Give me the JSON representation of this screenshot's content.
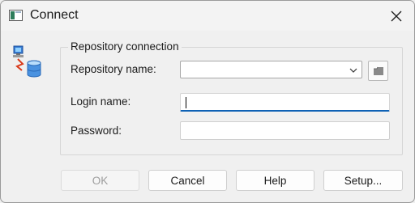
{
  "window": {
    "title": "Connect"
  },
  "icons": {
    "window": "window-app-icon",
    "close": "close-icon",
    "connection": "database-connection-icon",
    "dropdown": "chevron-down-icon",
    "browse": "folder-browse-icon"
  },
  "group": {
    "legend": "Repository connection",
    "repository_label": "Repository name:",
    "repository_value": "",
    "login_label": "Login name:",
    "login_value": "",
    "password_label": "Password:",
    "password_value": ""
  },
  "buttons": {
    "ok": "OK",
    "cancel": "Cancel",
    "help": "Help",
    "setup": "Setup..."
  },
  "colors": {
    "focus_accent": "#0f62b5",
    "background": "#f0f0f0"
  }
}
